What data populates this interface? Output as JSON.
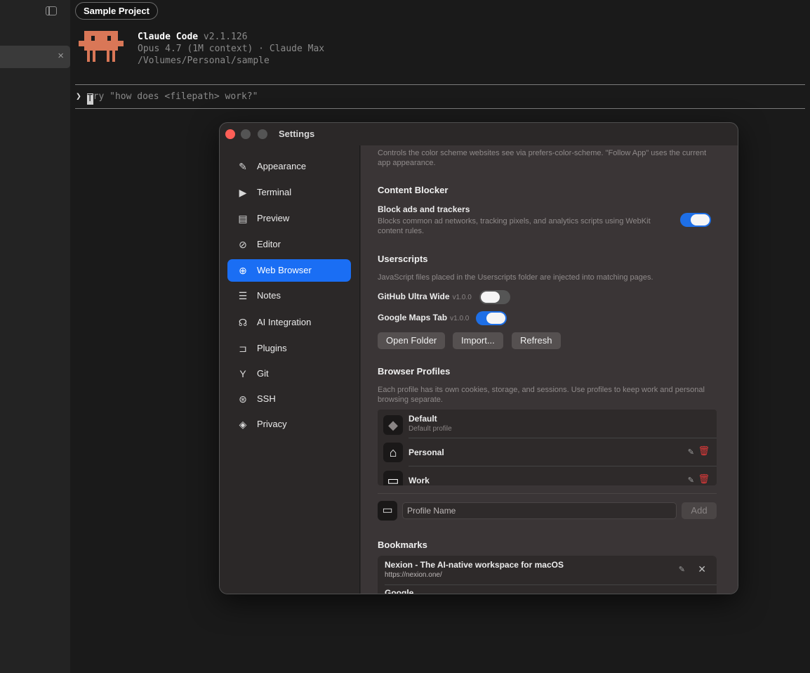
{
  "app": {
    "project_name": "Sample Project",
    "session_close": "×"
  },
  "terminal": {
    "product_name": "Claude Code",
    "version": "v2.1.126",
    "model_line": "Opus 4.7 (1M context) · Claude Max",
    "path_line": "/Volumes/Personal/sample",
    "prompt_symbol": "❯",
    "cursor_char": "T",
    "prompt_placeholder_rest": "ry \"how does <filepath> work?\""
  },
  "settings": {
    "window_title": "Settings",
    "nav": [
      {
        "label": "Appearance",
        "icon": "paintbrush-icon",
        "glyph": "✎"
      },
      {
        "label": "Terminal",
        "icon": "terminal-icon",
        "glyph": "▶"
      },
      {
        "label": "Preview",
        "icon": "document-icon",
        "glyph": "▤"
      },
      {
        "label": "Editor",
        "icon": "pencil-circle-icon",
        "glyph": "⊘"
      },
      {
        "label": "Web Browser",
        "icon": "globe-icon",
        "glyph": "⊕",
        "active": true
      },
      {
        "label": "Notes",
        "icon": "notes-icon",
        "glyph": "☰"
      },
      {
        "label": "AI Integration",
        "icon": "brain-icon",
        "glyph": "☊"
      },
      {
        "label": "Plugins",
        "icon": "plugin-icon",
        "glyph": "⊐"
      },
      {
        "label": "Git",
        "icon": "git-branch-icon",
        "glyph": "Y"
      },
      {
        "label": "SSH",
        "icon": "network-icon",
        "glyph": "⊛"
      },
      {
        "label": "Privacy",
        "icon": "shield-icon",
        "glyph": "◈"
      }
    ],
    "content": {
      "color_scheme_desc": "Controls the color scheme websites see via prefers-color-scheme. \"Follow App\" uses the current app appearance.",
      "content_blocker": {
        "heading": "Content Blocker",
        "row_title": "Block ads and trackers",
        "row_desc": "Blocks common ad networks, tracking pixels, and analytics scripts using WebKit content rules.",
        "enabled": true
      },
      "userscripts": {
        "heading": "Userscripts",
        "desc": "JavaScript files placed in the Userscripts folder are injected into matching pages.",
        "scripts": [
          {
            "name": "GitHub Ultra Wide",
            "version": "v1.0.0",
            "enabled": false
          },
          {
            "name": "Google Maps Tab",
            "version": "v1.0.0",
            "enabled": true
          }
        ],
        "buttons": [
          "Open Folder",
          "Import...",
          "Refresh"
        ]
      },
      "profiles": {
        "heading": "Browser Profiles",
        "desc": "Each profile has its own cookies, storage, and sessions. Use profiles to keep work and personal browsing separate.",
        "items": [
          {
            "name": "Default",
            "subtitle": "Default profile",
            "icon": "diamond-icon",
            "glyph": "◆"
          },
          {
            "name": "Personal",
            "subtitle": "",
            "icon": "house-icon",
            "glyph": "⌂"
          },
          {
            "name": "Work",
            "subtitle": "",
            "icon": "laptop-icon",
            "glyph": "▭"
          }
        ],
        "new_icon_glyph": "▭",
        "input_placeholder": "Profile Name",
        "add_label": "Add"
      },
      "bookmarks": {
        "heading": "Bookmarks",
        "items": [
          {
            "title": "Nexion - The AI-native workspace for macOS",
            "url": "https://nexion.one/"
          },
          {
            "title": "Google",
            "url": ""
          }
        ]
      }
    }
  },
  "colors": {
    "accent": "#1a6ef4",
    "toggle_on": "#1e6fe6",
    "danger": "#e03a3a",
    "mascot": "#d97757"
  }
}
